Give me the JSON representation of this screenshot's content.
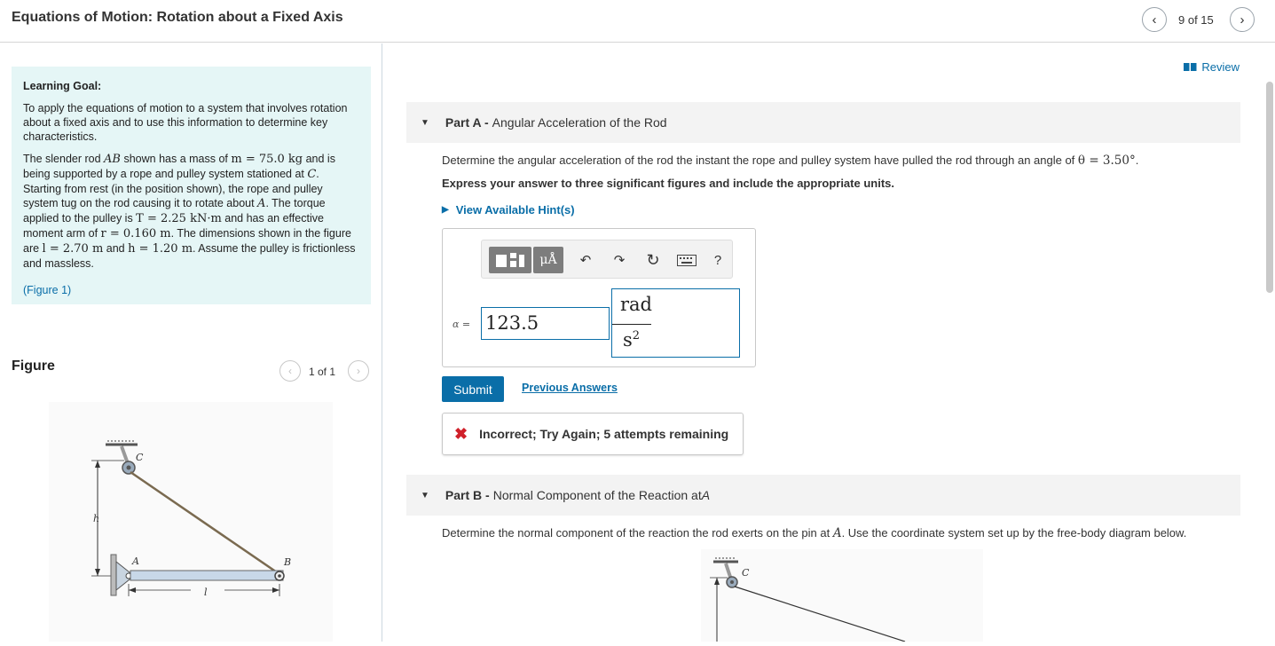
{
  "header": {
    "title": "Equations of Motion: Rotation about a Fixed Axis",
    "counter": "9 of 15",
    "prev_icon": "chevron-left-icon",
    "next_icon": "chevron-right-icon"
  },
  "goal": {
    "heading": "Learning Goal:",
    "paragraph1": "To apply the equations of motion to a system that involves rotation about a fixed axis and to use this information to determine key characteristics.",
    "p2": {
      "t1": "The slender rod ",
      "m1": "AB",
      "t2": " shown has a mass of ",
      "m2": "m = 75.0 kg",
      "t3": " and is being supported by a rope and pulley system stationed at ",
      "m3": "C",
      "t4": ". Starting from rest (in the position shown), the rope and pulley system tug on the rod causing it to rotate about ",
      "m4": "A",
      "t5": ". The torque applied to the pulley is ",
      "m5": "T = 2.25 kN·m",
      "t6": " and has an effective moment arm of ",
      "m6": "r = 0.160 m",
      "t7": ". The dimensions shown in the figure are ",
      "m7": "l = 2.70 m",
      "t8": " and ",
      "m8": "h = 1.20 m",
      "t9": ". Assume the pulley is frictionless and massless."
    },
    "figure_link": "(Figure 1)"
  },
  "figure": {
    "label": "Figure",
    "counter": "1 of 1",
    "labels": {
      "c": "C",
      "a": "A",
      "b": "B",
      "h": "h",
      "l": "l"
    }
  },
  "review": "Review",
  "partA": {
    "letter": "Part A -",
    "title": "Angular Acceleration of the Rod",
    "question_pre": "Determine the angular acceleration of the rod the instant the rope and pulley system have pulled the rod through an angle of ",
    "question_math": "θ = 3.50°",
    "question_post": ".",
    "instruction": "Express your answer to three significant figures and include the appropriate units.",
    "hints": "View Available Hint(s)",
    "toolbar": {
      "template_icon": "template-icon",
      "units_label": "μÅ",
      "undo_icon": "undo-icon",
      "redo_icon": "redo-icon",
      "reset_icon": "reset-icon",
      "keyboard_icon": "keyboard-icon",
      "help_label": "?"
    },
    "variable": "α =",
    "value": "123.5",
    "unit_numerator": "rad",
    "unit_denominator": "s",
    "unit_exponent": "2",
    "submit": "Submit",
    "previous_answers": "Previous Answers",
    "feedback": "Incorrect; Try Again; 5 attempts remaining"
  },
  "partB": {
    "letter": "Part B -",
    "title": "Normal Component of the Reaction at ",
    "title_var": "A",
    "question_pre": "Determine the normal component of the reaction the rod exerts on the pin at ",
    "question_var": "A",
    "question_post": ". Use the coordinate system set up by the free-body diagram below.",
    "fig_label_c": "C"
  }
}
